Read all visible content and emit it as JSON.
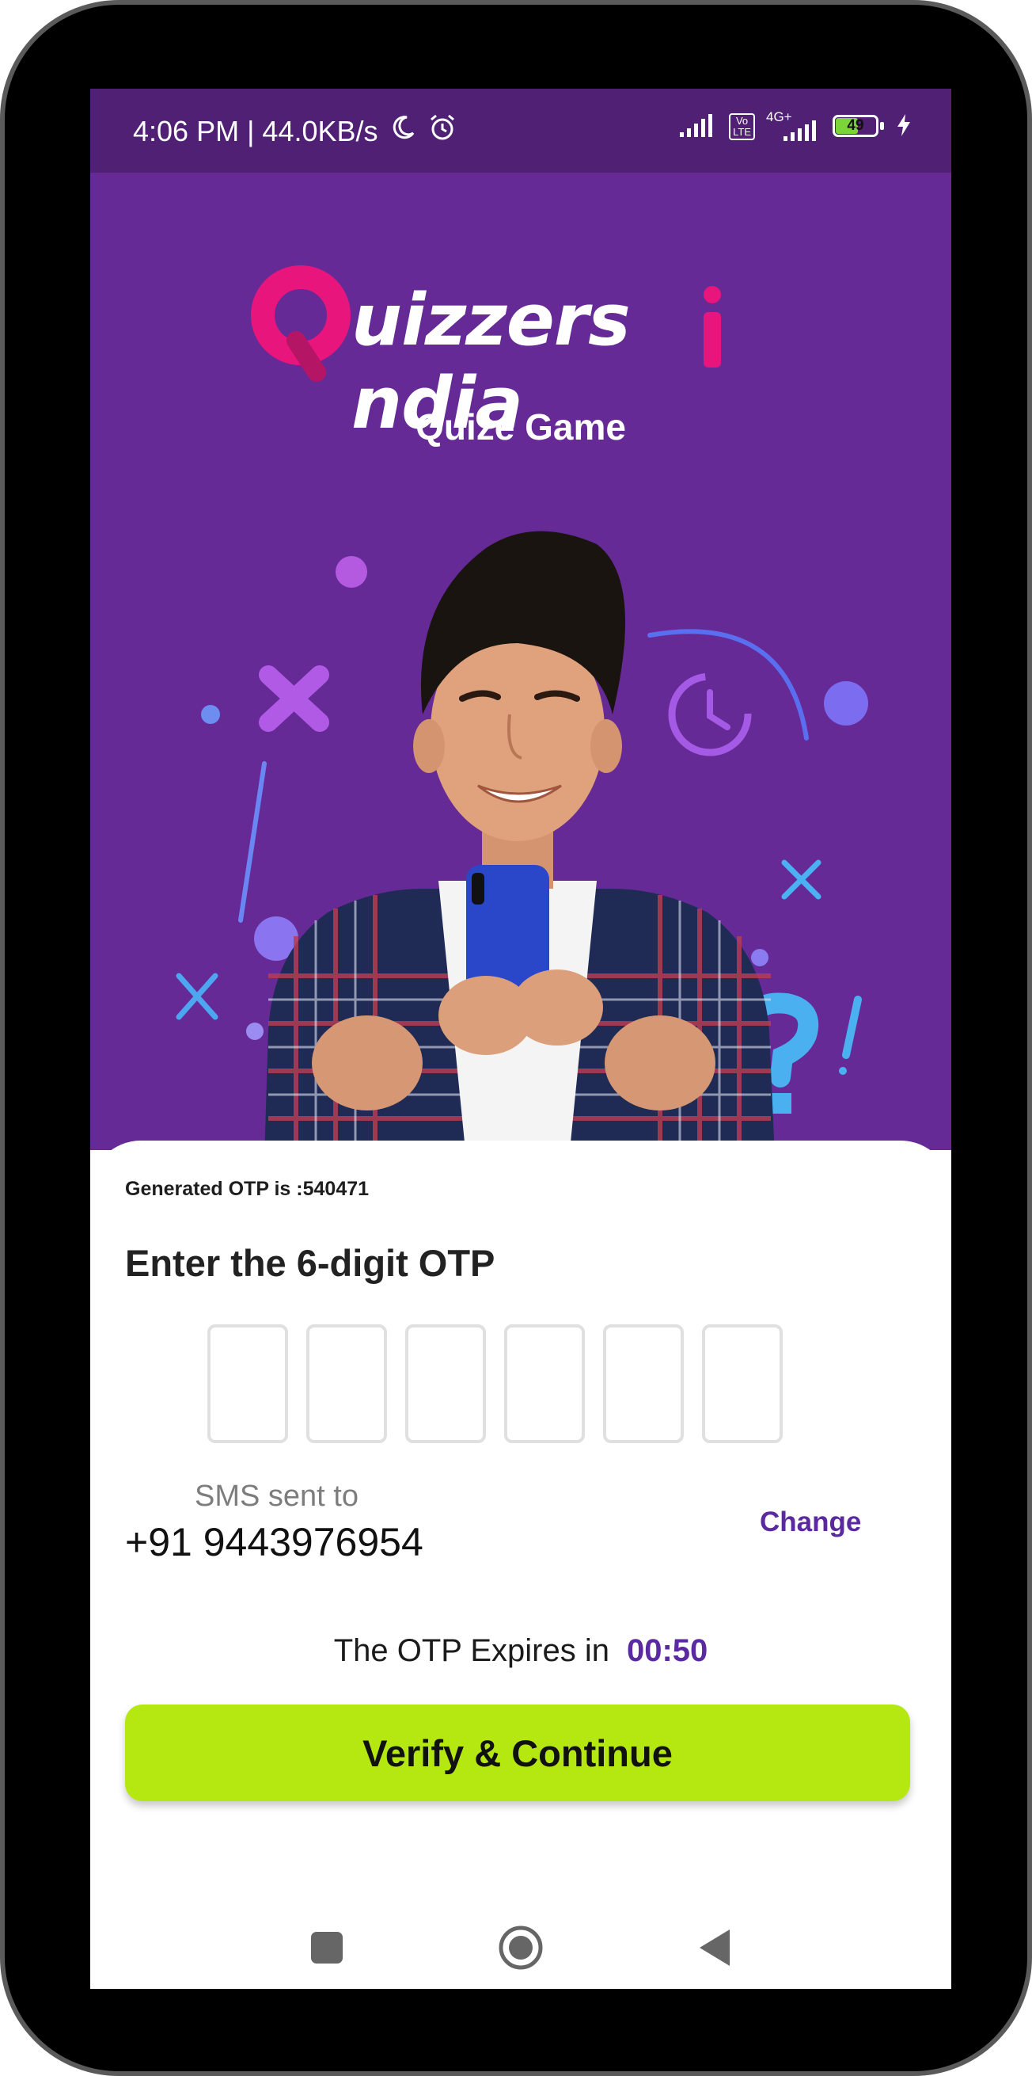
{
  "status_bar": {
    "time_speed": "4:06 PM | 44.0KB/s",
    "network": "4G+",
    "volte_top": "Vo",
    "volte_bottom": "LTE",
    "battery": "49"
  },
  "brand": {
    "logo_text": "uizzers ndia",
    "subtitle": "Quize Game"
  },
  "otp": {
    "generated_message": "Generated OTP is :540471",
    "heading": "Enter the 6-digit OTP",
    "digits": [
      "",
      "",
      "",
      "",
      "",
      ""
    ],
    "sms_sent_label": "SMS sent to",
    "phone_number": "+91 9443976954",
    "change_label": "Change",
    "expires_label": "The OTP Expires in",
    "expires_time": "00:50",
    "verify_button": "Verify & Continue"
  },
  "colors": {
    "primary_purple": "#662a96",
    "status_bar": "#4f2073",
    "accent_purple": "#5b2aa0",
    "logo_pink": "#e8157c",
    "button_lime": "#b5e811"
  },
  "icons": {
    "moon": "moon-icon",
    "alarm": "alarm-icon",
    "signal": "signal-icon",
    "battery": "battery-icon",
    "charging": "bolt-icon",
    "nav_recent": "square-icon",
    "nav_home": "circle-icon",
    "nav_back": "back-triangle-icon"
  }
}
